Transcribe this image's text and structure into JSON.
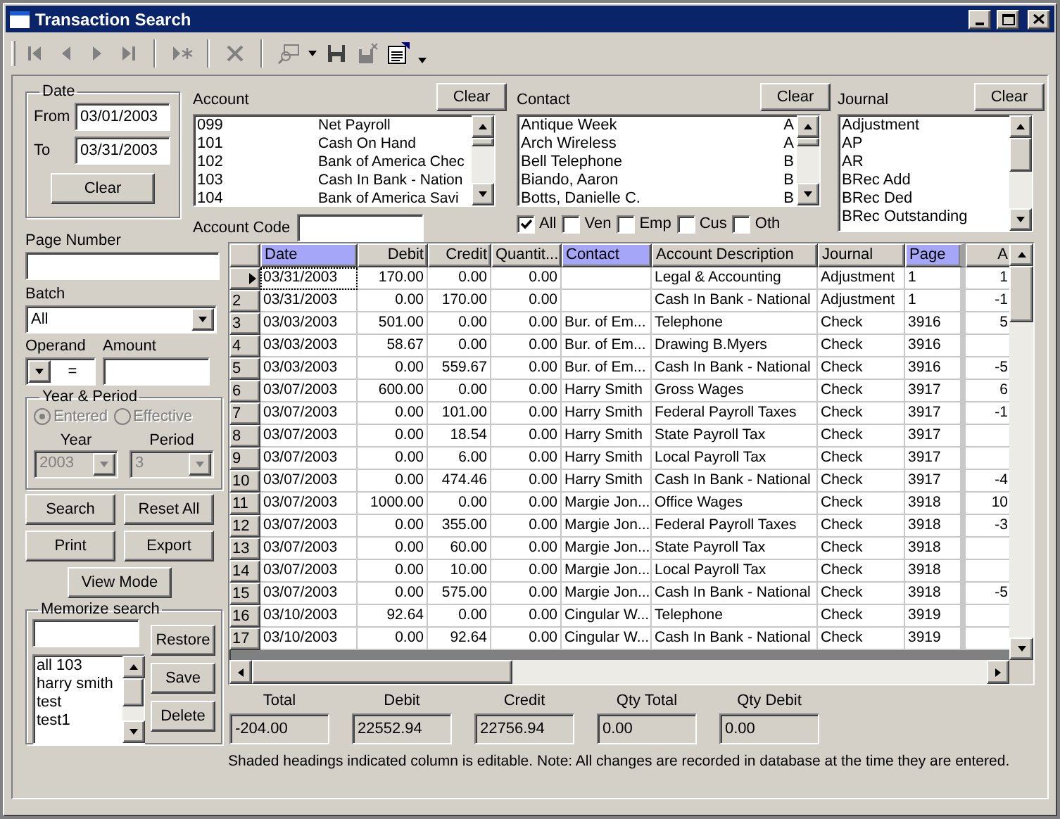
{
  "window": {
    "title": "Transaction Search"
  },
  "date_filter": {
    "title": "Date",
    "from_label": "From",
    "from": "03/01/2003",
    "to_label": "To",
    "to": "03/31/2003",
    "clear": "Clear"
  },
  "account": {
    "label": "Account",
    "clear": "Clear",
    "code_label": "Account Code",
    "items": [
      {
        "code": "099",
        "name": "Net Payroll"
      },
      {
        "code": "101",
        "name": "Cash On Hand"
      },
      {
        "code": "102",
        "name": "Bank of America Chec"
      },
      {
        "code": "103",
        "name": "Cash In Bank - Nation"
      },
      {
        "code": "104",
        "name": "Bank of America Savi"
      }
    ]
  },
  "contact": {
    "label": "Contact",
    "clear": "Clear",
    "items": [
      {
        "name": "Antique Week",
        "type": "A"
      },
      {
        "name": "Arch Wireless",
        "type": "A"
      },
      {
        "name": "Bell Telephone",
        "type": "B"
      },
      {
        "name": "Biando, Aaron",
        "type": "B"
      },
      {
        "name": "Botts, Danielle C.",
        "type": "B"
      }
    ],
    "filters": [
      {
        "label": "All",
        "checked": true
      },
      {
        "label": "Ven",
        "checked": false
      },
      {
        "label": "Emp",
        "checked": false
      },
      {
        "label": "Cus",
        "checked": false
      },
      {
        "label": "Oth",
        "checked": false
      }
    ]
  },
  "journal": {
    "label": "Journal",
    "clear": "Clear",
    "items": [
      "Adjustment",
      "AP",
      "AR",
      "BRec Add",
      "BRec Ded",
      "BRec Outstanding"
    ]
  },
  "page_number": {
    "label": "Page Number"
  },
  "batch": {
    "label": "Batch",
    "value": "All"
  },
  "operand": {
    "label": "Operand",
    "value": "="
  },
  "amount": {
    "label": "Amount"
  },
  "year_period": {
    "title": "Year & Period",
    "disabled": true,
    "options": [
      {
        "label": "Entered",
        "selected": true
      },
      {
        "label": "Effective",
        "selected": false
      }
    ],
    "year_label": "Year",
    "year": "2003",
    "period_label": "Period",
    "period": "3"
  },
  "buttons": [
    "Search",
    "Reset All",
    "Print",
    "Export",
    "View Mode"
  ],
  "memorize": {
    "title": "Memorize search",
    "items": [
      "all 103",
      "harry smith",
      "test",
      "test1"
    ],
    "buttons": [
      "Restore",
      "Save",
      "Delete"
    ]
  },
  "table": {
    "columns": [
      {
        "label": "Date",
        "kind": "text",
        "editable": true
      },
      {
        "label": "Debit",
        "kind": "number",
        "editable": false
      },
      {
        "label": "Credit",
        "kind": "number",
        "editable": false
      },
      {
        "label": "Quantit...",
        "kind": "number",
        "editable": false
      },
      {
        "label": "Contact",
        "kind": "text",
        "editable": true
      },
      {
        "label": "Account Description",
        "kind": "text",
        "editable": false
      },
      {
        "label": "Journal",
        "kind": "text",
        "editable": false
      },
      {
        "label": "Page",
        "kind": "text",
        "editable": true
      },
      {
        "label": "A",
        "kind": "number",
        "editable": false
      }
    ],
    "rows": [
      {
        "selected": true,
        "cells": [
          "03/31/2003",
          "170.00",
          "0.00",
          "0.00",
          null,
          "Legal & Accounting",
          "Adjustment",
          "1",
          "1"
        ]
      },
      {
        "number": "2",
        "selected": false,
        "cells": [
          "03/31/2003",
          "0.00",
          "170.00",
          "0.00",
          null,
          "Cash In Bank - National",
          "Adjustment",
          "1",
          "-1"
        ]
      },
      {
        "number": "3",
        "selected": false,
        "cells": [
          "03/03/2003",
          "501.00",
          "0.00",
          "0.00",
          "Bur. of Em...",
          "Telephone",
          "Check",
          "3916",
          "5"
        ]
      },
      {
        "number": "4",
        "selected": false,
        "cells": [
          "03/03/2003",
          "58.67",
          "0.00",
          "0.00",
          "Bur. of Em...",
          "Drawing B.Myers",
          "Check",
          "3916",
          null
        ]
      },
      {
        "number": "5",
        "selected": false,
        "cells": [
          "03/03/2003",
          "0.00",
          "559.67",
          "0.00",
          "Bur. of Em...",
          "Cash In Bank - National",
          "Check",
          "3916",
          "-5"
        ]
      },
      {
        "number": "6",
        "selected": false,
        "cells": [
          "03/07/2003",
          "600.00",
          "0.00",
          "0.00",
          "Harry Smith",
          "Gross Wages",
          "Check",
          "3917",
          "6"
        ]
      },
      {
        "number": "7",
        "selected": false,
        "cells": [
          "03/07/2003",
          "0.00",
          "101.00",
          "0.00",
          "Harry Smith",
          "Federal Payroll Taxes",
          "Check",
          "3917",
          "-1"
        ]
      },
      {
        "number": "8",
        "selected": false,
        "cells": [
          "03/07/2003",
          "0.00",
          "18.54",
          "0.00",
          "Harry Smith",
          "State Payroll Tax",
          "Check",
          "3917",
          null
        ]
      },
      {
        "number": "9",
        "selected": false,
        "cells": [
          "03/07/2003",
          "0.00",
          "6.00",
          "0.00",
          "Harry Smith",
          "Local Payroll Tax",
          "Check",
          "3917",
          null
        ]
      },
      {
        "number": "10",
        "selected": false,
        "cells": [
          "03/07/2003",
          "0.00",
          "474.46",
          "0.00",
          "Harry Smith",
          "Cash In Bank - National",
          "Check",
          "3917",
          "-4"
        ]
      },
      {
        "number": "11",
        "selected": false,
        "cells": [
          "03/07/2003",
          "1000.00",
          "0.00",
          "0.00",
          "Margie Jon...",
          "Office Wages",
          "Check",
          "3918",
          "10"
        ]
      },
      {
        "number": "12",
        "selected": false,
        "cells": [
          "03/07/2003",
          "0.00",
          "355.00",
          "0.00",
          "Margie Jon...",
          "Federal Payroll Taxes",
          "Check",
          "3918",
          "-3"
        ]
      },
      {
        "number": "13",
        "selected": false,
        "cells": [
          "03/07/2003",
          "0.00",
          "60.00",
          "0.00",
          "Margie Jon...",
          "State Payroll Tax",
          "Check",
          "3918",
          null
        ]
      },
      {
        "number": "14",
        "selected": false,
        "cells": [
          "03/07/2003",
          "0.00",
          "10.00",
          "0.00",
          "Margie Jon...",
          "Local Payroll Tax",
          "Check",
          "3918",
          null
        ]
      },
      {
        "number": "15",
        "selected": false,
        "cells": [
          "03/07/2003",
          "0.00",
          "575.00",
          "0.00",
          "Margie Jon...",
          "Cash In Bank - National",
          "Check",
          "3918",
          "-5"
        ]
      },
      {
        "number": "16",
        "selected": false,
        "cells": [
          "03/10/2003",
          "92.64",
          "0.00",
          "0.00",
          "Cingular W...",
          "Telephone",
          "Check",
          "3919",
          null
        ]
      },
      {
        "number": "17",
        "selected": false,
        "cells": [
          "03/10/2003",
          "0.00",
          "92.64",
          "0.00",
          "Cingular W...",
          "Cash In Bank - National",
          "Check",
          "3919",
          null
        ]
      }
    ]
  },
  "totals": [
    {
      "label": "Total",
      "value": "-204.00"
    },
    {
      "label": "Debit",
      "value": "22552.94"
    },
    {
      "label": "Credit",
      "value": "22756.94"
    },
    {
      "label": "Qty Total",
      "value": "0.00"
    },
    {
      "label": "Qty Debit",
      "value": "0.00"
    }
  ],
  "note": "Shaded headings indicated column is editable. Note: All changes are recorded in database at the time they are  entered."
}
